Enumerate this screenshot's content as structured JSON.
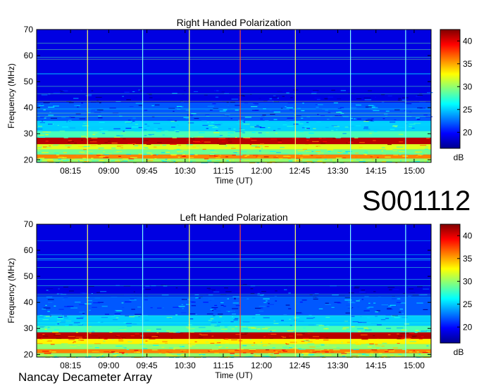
{
  "observation_id": "S001112",
  "observatory": "Nancay Decameter Array",
  "colors": {
    "background": "#ffffff",
    "colormap": "jet",
    "line_yellow": "#ffff60",
    "line_red": "#ff5030",
    "line_cyan": "#80ffff"
  },
  "chart_data": [
    {
      "type": "heatmap",
      "title": "Right Handed Polarization",
      "xlabel": "Time (UT)",
      "ylabel": "Frequency (MHz)",
      "x_ticks": [
        "08:15",
        "09:00",
        "09:45",
        "10:30",
        "11:15",
        "12:00",
        "12:45",
        "13:30",
        "14:15",
        "15:00"
      ],
      "xlim": [
        "07:35",
        "15:20"
      ],
      "y_ticks": [
        20,
        30,
        40,
        50,
        60,
        70
      ],
      "ylim": [
        19,
        70
      ],
      "colorbar": {
        "label": "dB",
        "ticks": [
          20,
          25,
          30,
          35,
          40
        ],
        "range": [
          16.5,
          42.5
        ]
      },
      "bands": [
        {
          "freq_range": [
            19,
            20.5
          ],
          "level_db": 30
        },
        {
          "freq_range": [
            20.5,
            22
          ],
          "level_db": 36
        },
        {
          "freq_range": [
            22,
            24
          ],
          "level_db": 29
        },
        {
          "freq_range": [
            24,
            26
          ],
          "level_db": 32
        },
        {
          "freq_range": [
            26,
            28.5
          ],
          "level_db": 41
        },
        {
          "freq_range": [
            28.5,
            31
          ],
          "level_db": 28
        },
        {
          "freq_range": [
            31,
            35
          ],
          "level_db": 25
        },
        {
          "freq_range": [
            35,
            42
          ],
          "level_db": 22
        },
        {
          "freq_range": [
            42,
            70
          ],
          "level_db": 19
        }
      ],
      "vertical_lines": [
        {
          "time": "08:35",
          "color": "yellow"
        },
        {
          "time": "09:40",
          "color": "cyan"
        },
        {
          "time": "10:35",
          "color": "yellow"
        },
        {
          "time": "11:35",
          "color": "red"
        },
        {
          "time": "12:40",
          "color": "yellow"
        },
        {
          "time": "13:45",
          "color": "cyan"
        },
        {
          "time": "14:50",
          "color": "cyan"
        }
      ]
    },
    {
      "type": "heatmap",
      "title": "Left Handed Polarization",
      "xlabel": "Time (UT)",
      "ylabel": "Frequency (MHz)",
      "x_ticks": [
        "08:15",
        "09:00",
        "09:45",
        "10:30",
        "11:15",
        "12:00",
        "12:45",
        "13:30",
        "14:15",
        "15:00"
      ],
      "xlim": [
        "07:35",
        "15:20"
      ],
      "y_ticks": [
        20,
        30,
        40,
        50,
        60,
        70
      ],
      "ylim": [
        19,
        70
      ],
      "colorbar": {
        "label": "dB",
        "ticks": [
          20,
          25,
          30,
          35,
          40
        ],
        "range": [
          16.5,
          42.5
        ]
      },
      "bands": [
        {
          "freq_range": [
            19,
            20.5
          ],
          "level_db": 30
        },
        {
          "freq_range": [
            20.5,
            22
          ],
          "level_db": 36
        },
        {
          "freq_range": [
            22,
            24
          ],
          "level_db": 30
        },
        {
          "freq_range": [
            24,
            26
          ],
          "level_db": 33
        },
        {
          "freq_range": [
            26,
            28.5
          ],
          "level_db": 41
        },
        {
          "freq_range": [
            28.5,
            31
          ],
          "level_db": 28
        },
        {
          "freq_range": [
            31,
            35
          ],
          "level_db": 25
        },
        {
          "freq_range": [
            35,
            42
          ],
          "level_db": 22
        },
        {
          "freq_range": [
            42,
            70
          ],
          "level_db": 19
        }
      ],
      "vertical_lines": [
        {
          "time": "08:35",
          "color": "yellow"
        },
        {
          "time": "09:40",
          "color": "cyan"
        },
        {
          "time": "10:35",
          "color": "yellow"
        },
        {
          "time": "11:35",
          "color": "red"
        },
        {
          "time": "12:40",
          "color": "yellow"
        },
        {
          "time": "13:45",
          "color": "cyan"
        },
        {
          "time": "14:50",
          "color": "cyan"
        }
      ]
    }
  ]
}
